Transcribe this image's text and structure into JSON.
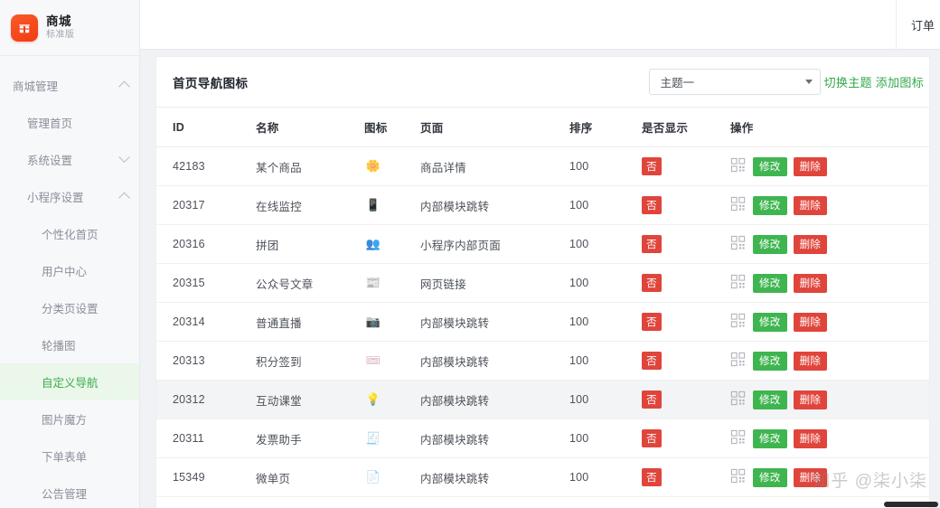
{
  "brand": {
    "title": "商城",
    "subtitle": "标准版",
    "logo_icon": "shop-icon",
    "logo_color": "#f23c14"
  },
  "sidebar": {
    "items": [
      {
        "label": "商城管理",
        "level": 1,
        "icon": "chevron-up-icon",
        "active": false
      },
      {
        "label": "管理首页",
        "level": 2,
        "icon": "",
        "active": false
      },
      {
        "label": "系统设置",
        "level": 2,
        "icon": "chevron-down-icon",
        "active": false
      },
      {
        "label": "小程序设置",
        "level": 2,
        "icon": "chevron-up-icon",
        "active": false
      },
      {
        "label": "个性化首页",
        "level": 3,
        "icon": "",
        "active": false
      },
      {
        "label": "用户中心",
        "level": 3,
        "icon": "",
        "active": false
      },
      {
        "label": "分类页设置",
        "level": 3,
        "icon": "",
        "active": false
      },
      {
        "label": "轮播图",
        "level": 3,
        "icon": "",
        "active": false
      },
      {
        "label": "自定义导航",
        "level": 3,
        "icon": "",
        "active": true
      },
      {
        "label": "图片魔方",
        "level": 3,
        "icon": "",
        "active": false
      },
      {
        "label": "下单表单",
        "level": 3,
        "icon": "",
        "active": false
      },
      {
        "label": "公告管理",
        "level": 3,
        "icon": "",
        "active": false
      }
    ]
  },
  "topbar": {
    "item_label": "订单"
  },
  "card": {
    "title": "首页导航图标",
    "theme_select": {
      "value": "主题一",
      "caret_icon": "chevron-down-icon"
    },
    "switch_theme_label": "切换主题",
    "add_icon_label": "添加图标",
    "link_color": "#31a84a"
  },
  "table": {
    "columns": [
      "ID",
      "名称",
      "图标",
      "页面",
      "排序",
      "是否显示",
      "操作"
    ],
    "ops": {
      "qr_icon": "qrcode-icon",
      "edit_label": "修改",
      "delete_label": "删除",
      "edit_color": "#3fb550",
      "delete_color": "#e0453c"
    },
    "rows": [
      {
        "id": "42183",
        "name": "某个商品",
        "icon": "flower-icon",
        "page": "商品详情",
        "sort": "100",
        "show": "否",
        "highlighted": false
      },
      {
        "id": "20317",
        "name": "在线监控",
        "icon": "monitor-icon",
        "page": "内部模块跳转",
        "sort": "100",
        "show": "否",
        "highlighted": false
      },
      {
        "id": "20316",
        "name": "拼团",
        "icon": "group-icon",
        "page": "小程序内部页面",
        "sort": "100",
        "show": "否",
        "highlighted": false
      },
      {
        "id": "20315",
        "name": "公众号文章",
        "icon": "article-icon",
        "page": "网页链接",
        "sort": "100",
        "show": "否",
        "highlighted": false
      },
      {
        "id": "20314",
        "name": "普通直播",
        "icon": "live-icon",
        "page": "内部模块跳转",
        "sort": "100",
        "show": "否",
        "highlighted": false
      },
      {
        "id": "20313",
        "name": "积分签到",
        "icon": "points-icon",
        "page": "内部模块跳转",
        "sort": "100",
        "show": "否",
        "highlighted": false
      },
      {
        "id": "20312",
        "name": "互动课堂",
        "icon": "class-icon",
        "page": "内部模块跳转",
        "sort": "100",
        "show": "否",
        "highlighted": true
      },
      {
        "id": "20311",
        "name": "发票助手",
        "icon": "invoice-icon",
        "page": "内部模块跳转",
        "sort": "100",
        "show": "否",
        "highlighted": false
      },
      {
        "id": "15349",
        "name": "微单页",
        "icon": "page-icon",
        "page": "内部模块跳转",
        "sort": "100",
        "show": "否",
        "highlighted": false
      }
    ]
  },
  "overlay": {
    "highlight_box_color": "#ee1c1c",
    "watermark": "知乎 @柒小柒"
  }
}
